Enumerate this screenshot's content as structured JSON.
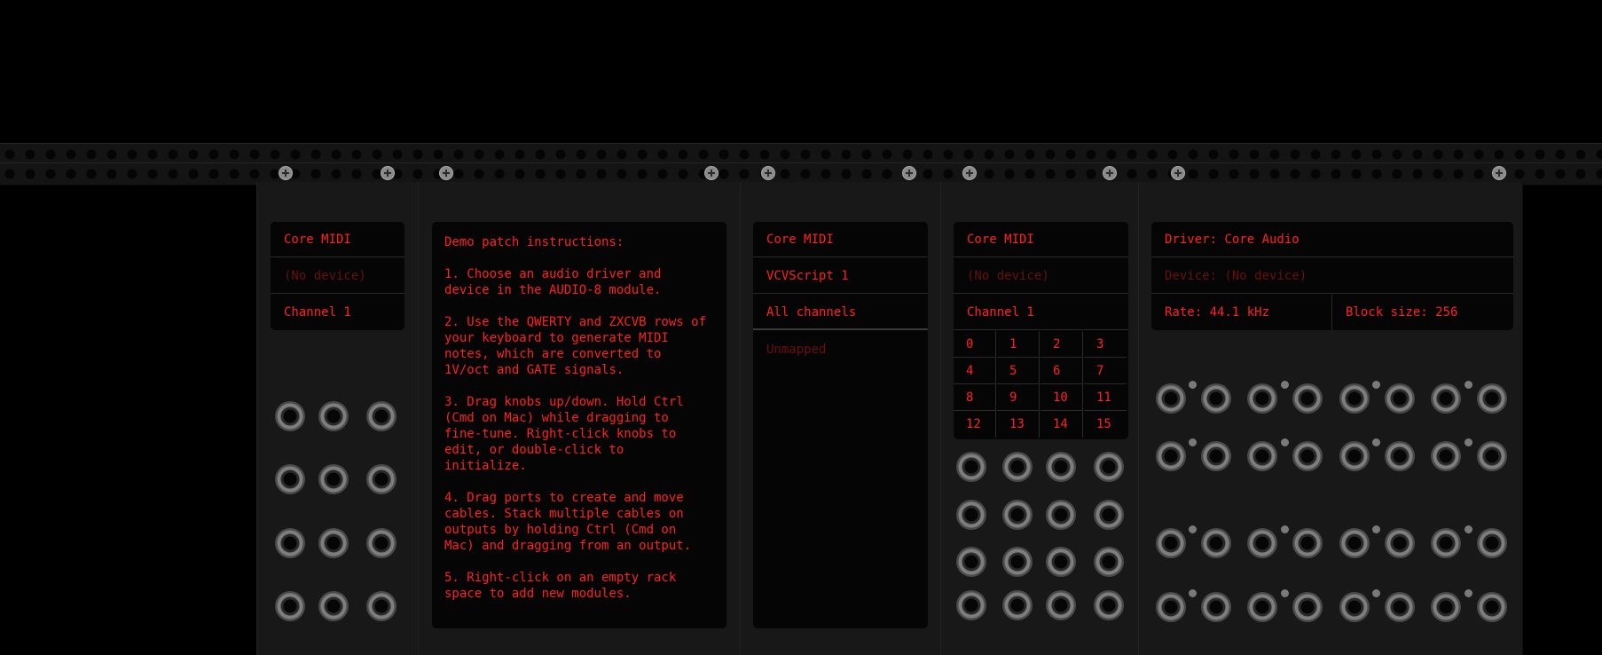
{
  "midi_cv": {
    "driver": "Core MIDI",
    "device": "(No device)",
    "channel": "Channel 1"
  },
  "notes": {
    "text": "Demo patch instructions:\n\n1. Choose an audio driver and\ndevice in the AUDIO-8 module.\n\n2. Use the QWERTY and ZXCVB rows of\nyour keyboard to generate MIDI\nnotes, which are converted to\n1V/oct and GATE signals.\n\n3. Drag knobs up/down. Hold Ctrl\n(Cmd on Mac) while dragging to\nfine-tune. Right-click knobs to\nedit, or double-click to\ninitialize.\n\n4. Drag ports to create and move\ncables. Stack multiple cables on\noutputs by holding Ctrl (Cmd on\nMac) and dragging from an output.\n\n5. Right-click on an empty rack\nspace to add new modules."
  },
  "midi_map": {
    "driver": "Core MIDI",
    "device": "VCVScript 1",
    "channel": "All channels",
    "mapping": "Unmapped"
  },
  "midi_trig": {
    "driver": "Core MIDI",
    "device": "(No device)",
    "channel": "Channel 1",
    "cells": [
      "0",
      "1",
      "2",
      "3",
      "4",
      "5",
      "6",
      "7",
      "8",
      "9",
      "10",
      "11",
      "12",
      "13",
      "14",
      "15"
    ]
  },
  "audio": {
    "driver": "Driver: Core Audio",
    "device": "Device: (No device)",
    "rate": "Rate: 44.1 kHz",
    "block": "Block size: 256"
  },
  "colors": {
    "display_text": "#ff2020",
    "display_dim": "#6a0e0e",
    "panel": "#181818"
  }
}
